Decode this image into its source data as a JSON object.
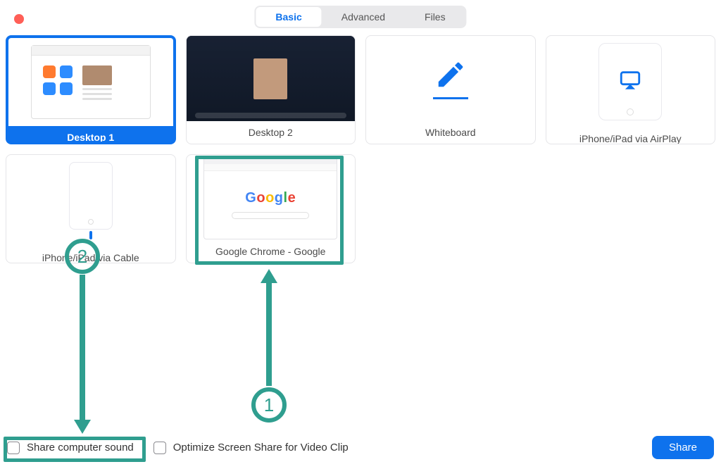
{
  "colors": {
    "accent": "#0e72ed",
    "annotation": "#2f9e8f",
    "close": "#ff5f57"
  },
  "tabs": {
    "basic": "Basic",
    "advanced": "Advanced",
    "files": "Files",
    "active": "basic"
  },
  "sources": {
    "desktop1": "Desktop 1",
    "desktop2": "Desktop 2",
    "whiteboard": "Whiteboard",
    "airplay": "iPhone/iPad via AirPlay",
    "cable": "iPhone/iPad via Cable",
    "chrome": "Google Chrome - Google"
  },
  "chrome_preview": {
    "logo_text": "Google"
  },
  "options": {
    "share_sound": "Share computer sound",
    "optimize_video": "Optimize Screen Share for Video Clip"
  },
  "buttons": {
    "share": "Share"
  },
  "annotations": {
    "step1": "1",
    "step2": "2"
  }
}
